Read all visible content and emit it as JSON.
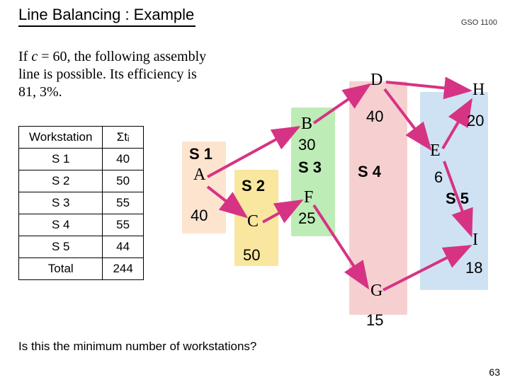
{
  "title": "Line Balancing : Example",
  "course_code": "GSO 1100",
  "description_prefix": "If ",
  "description_c": "c",
  "description_rest": " = 60, the following assembly line is possible. Its efficiency is 81, 3%.",
  "table": {
    "headers": {
      "col1": "Workstation",
      "col2": "Σtᵢ"
    },
    "rows": [
      {
        "ws": "S 1",
        "t": "40"
      },
      {
        "ws": "S 2",
        "t": "50"
      },
      {
        "ws": "S 3",
        "t": "55"
      },
      {
        "ws": "S 4",
        "t": "55"
      },
      {
        "ws": "S 5",
        "t": "44"
      },
      {
        "ws": "Total",
        "t": "244"
      }
    ]
  },
  "stations": {
    "S1": "S 1",
    "S2": "S 2",
    "S3": "S 3",
    "S4": "S 4",
    "S5": "S 5"
  },
  "nodes": {
    "A": {
      "label": "A",
      "value": "40"
    },
    "B": {
      "label": "B",
      "value": "30"
    },
    "C": {
      "label": "C",
      "value": "50"
    },
    "D": {
      "label": "D",
      "value": "40"
    },
    "E": {
      "label": "E",
      "value": "6"
    },
    "F": {
      "label": "F",
      "value": "25"
    },
    "G": {
      "label": "G",
      "value": "15"
    },
    "H": {
      "label": "H",
      "value": "20"
    },
    "I": {
      "label": "I",
      "value": "18"
    }
  },
  "question": "Is this the minimum number of workstations?",
  "page_number": "63",
  "chart_data": {
    "type": "table",
    "title": "Workstation task-time totals (Σtᵢ)",
    "categories": [
      "S 1",
      "S 2",
      "S 3",
      "S 4",
      "S 5",
      "Total"
    ],
    "values": [
      40,
      50,
      55,
      55,
      44,
      244
    ],
    "xlabel": "Workstation",
    "ylabel": "Σtᵢ",
    "ylim": [
      0,
      250
    ],
    "cycle_time_c": 60,
    "efficiency_pct": 81.3,
    "tasks": [
      {
        "id": "A",
        "time": 40,
        "station": "S1"
      },
      {
        "id": "B",
        "time": 30,
        "station": "S3"
      },
      {
        "id": "C",
        "time": 50,
        "station": "S2"
      },
      {
        "id": "D",
        "time": 40,
        "station": "S4"
      },
      {
        "id": "E",
        "time": 6,
        "station": "S5"
      },
      {
        "id": "F",
        "time": 25,
        "station": "S3"
      },
      {
        "id": "G",
        "time": 15,
        "station": "S4"
      },
      {
        "id": "H",
        "time": 20,
        "station": "S5"
      },
      {
        "id": "I",
        "time": 18,
        "station": "S5"
      }
    ],
    "edges": [
      [
        "A",
        "B"
      ],
      [
        "A",
        "C"
      ],
      [
        "B",
        "D"
      ],
      [
        "C",
        "F"
      ],
      [
        "D",
        "E"
      ],
      [
        "F",
        "G"
      ],
      [
        "D",
        "H"
      ],
      [
        "E",
        "H"
      ],
      [
        "E",
        "I"
      ],
      [
        "G",
        "I"
      ]
    ]
  }
}
